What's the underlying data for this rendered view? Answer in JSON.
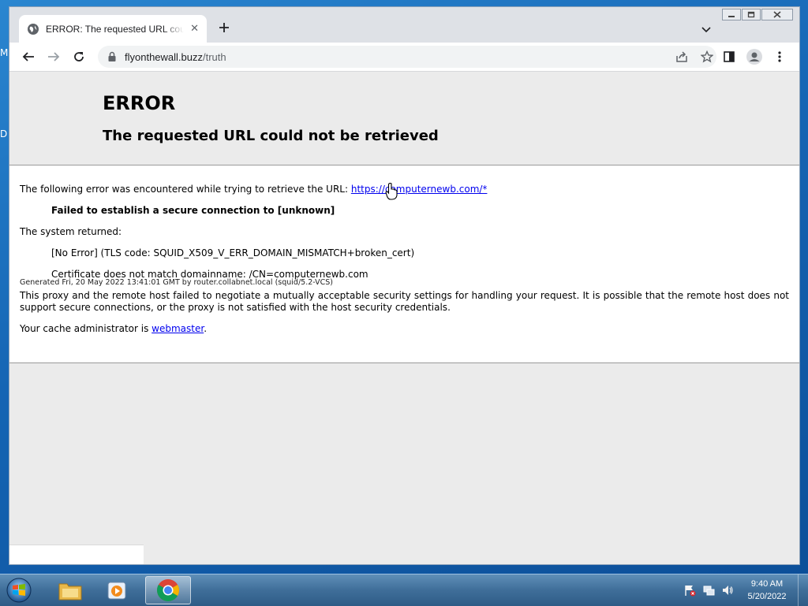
{
  "desktop": {
    "glyph_1": "M",
    "glyph_2": "D"
  },
  "browser": {
    "tab_title": "ERROR: The requested URL could not be retrieved",
    "url_host": "flyonthewall.buzz",
    "url_path": "/truth"
  },
  "page": {
    "heading": "ERROR",
    "subheading": "The requested URL could not be retrieved",
    "intro_text": "The following error was encountered while trying to retrieve the URL: ",
    "intro_link": "https://computernewb.com/*",
    "error_title": "Failed to establish a secure connection to [unknown]",
    "system_returned": "The system returned:",
    "tls_error": "[No Error] (TLS code: SQUID_X509_V_ERR_DOMAIN_MISMATCH+broken_cert)",
    "cert_error": "Certificate does not match domainname: /CN=computernewb.com",
    "explanation": "This proxy and the remote host failed to negotiate a mutually acceptable security settings for handling your request. It is possible that the remote host does not support secure connections, or the proxy is not satisfied with the host security credentials.",
    "admin_prefix": "Your cache administrator is ",
    "admin_link": "webmaster",
    "admin_suffix": ".",
    "footer": "Generated Fri, 20 May 2022 13:41:01 GMT by router.collabnet.local (squid/5.2-VCS)"
  },
  "taskbar": {
    "items": [
      "explorer-icon",
      "media-player-icon",
      "chrome-icon"
    ],
    "time": "9:40 AM",
    "date": "5/20/2022"
  },
  "colors": {
    "link": "#0000ee",
    "page_bg": "#ebebeb",
    "taskbar": "#3f6e99"
  }
}
